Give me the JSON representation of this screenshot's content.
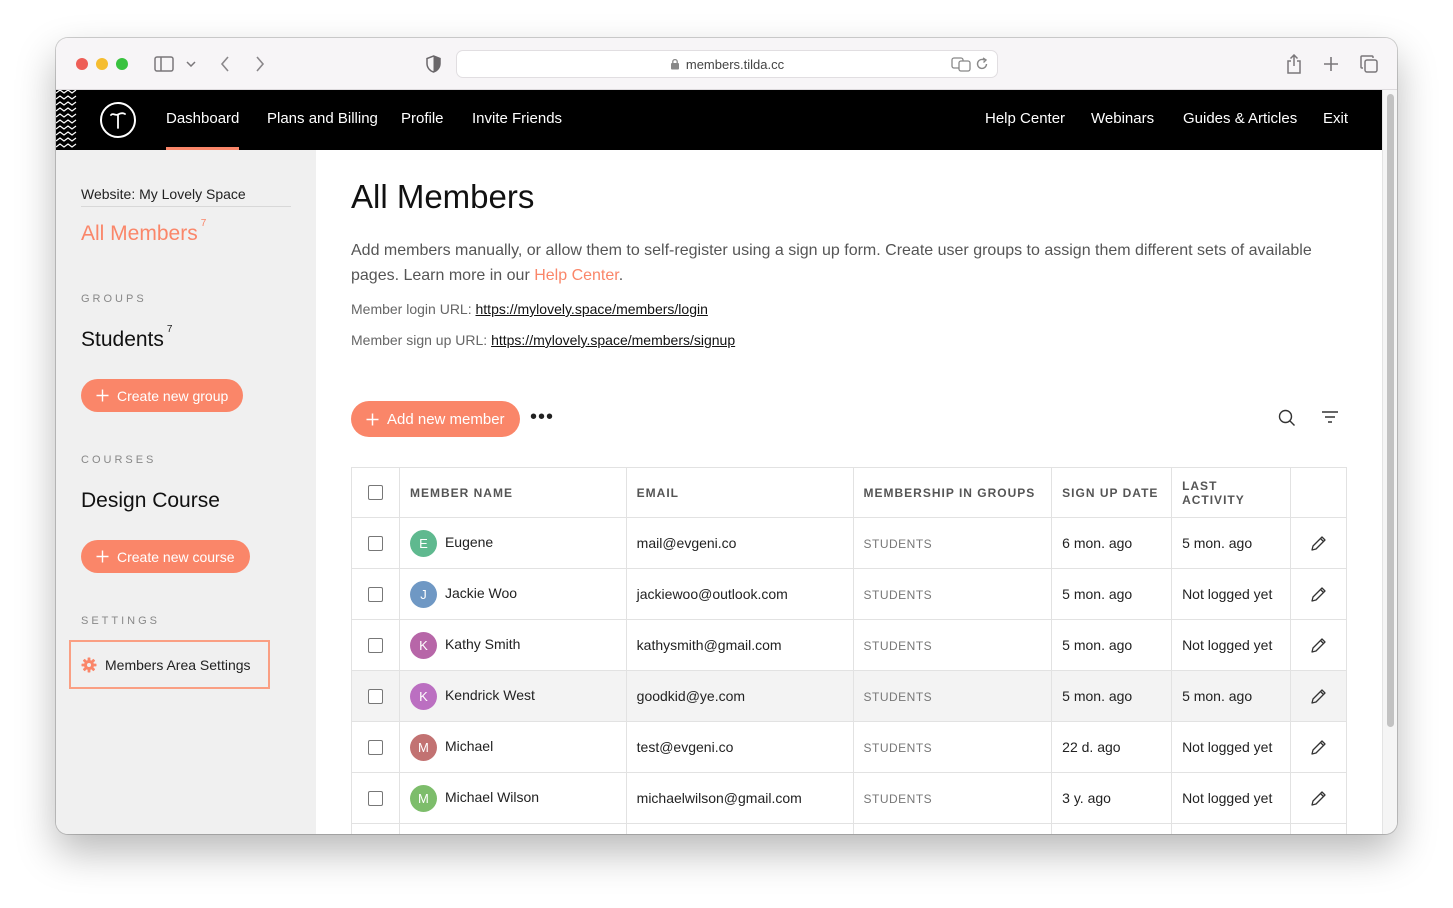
{
  "browser": {
    "url": "members.tilda.cc"
  },
  "nav": {
    "left": [
      "Dashboard",
      "Plans and Billing",
      "Profile",
      "Invite Friends"
    ],
    "right": [
      "Help Center",
      "Webinars",
      "Guides & Articles",
      "Exit"
    ]
  },
  "sidebar": {
    "website_label": "Website: My Lovely Space",
    "all_members_label": "All Members",
    "all_members_count": "7",
    "groups_heading": "GROUPS",
    "group_name": "Students",
    "group_count": "7",
    "create_group_label": "Create new group",
    "courses_heading": "COURSES",
    "course_name": "Design Course",
    "create_course_label": "Create new course",
    "settings_heading": "SETTINGS",
    "settings_item_label": "Members Area Settings"
  },
  "main": {
    "title": "All Members",
    "description": "Add members manually, or allow them to self-register using a sign up form. Create user groups to assign them different sets of available pages. Learn more in our ",
    "help_link": "Help Center",
    "description_end": ".",
    "login_url_label": "Member login URL: ",
    "login_url": "https://mylovely.space/members/login",
    "signup_url_label": "Member sign up URL: ",
    "signup_url": "https://mylovely.space/members/signup",
    "add_member_label": "Add new member",
    "more_label": "•••"
  },
  "table": {
    "headers": [
      "MEMBER NAME",
      "EMAIL",
      "MEMBERSHIP IN GROUPS",
      "SIGN UP DATE",
      "LAST ACTIVITY"
    ],
    "rows": [
      {
        "initial": "E",
        "name": "Eugene",
        "email": "mail@evgeni.co",
        "group": "STUDENTS",
        "signup": "6 mon. ago",
        "activity": "5 mon. ago",
        "color": "#5fb98f"
      },
      {
        "initial": "J",
        "name": "Jackie Woo",
        "email": "jackiewoo@outlook.com",
        "group": "STUDENTS",
        "signup": "5 mon. ago",
        "activity": "Not logged yet",
        "color": "#6f98c4"
      },
      {
        "initial": "K",
        "name": "Kathy Smith",
        "email": "kathysmith@gmail.com",
        "group": "STUDENTS",
        "signup": "5 mon. ago",
        "activity": "Not logged yet",
        "color": "#b766a8"
      },
      {
        "initial": "K",
        "name": "Kendrick West",
        "email": "goodkid@ye.com",
        "group": "STUDENTS",
        "signup": "5 mon. ago",
        "activity": "5 mon. ago",
        "color": "#bb6fc1"
      },
      {
        "initial": "M",
        "name": "Michael",
        "email": "test@evgeni.co",
        "group": "STUDENTS",
        "signup": "22 d. ago",
        "activity": "Not logged yet",
        "color": "#c27272"
      },
      {
        "initial": "M",
        "name": "Michael Wilson",
        "email": "michaelwilson@gmail.com",
        "group": "STUDENTS",
        "signup": "3 y. ago",
        "activity": "Not logged yet",
        "color": "#7dbd6b"
      }
    ]
  },
  "colors": {
    "accent": "#fa8669",
    "nav_bg": "#000000",
    "sidebar_bg": "#f0f0f0"
  }
}
